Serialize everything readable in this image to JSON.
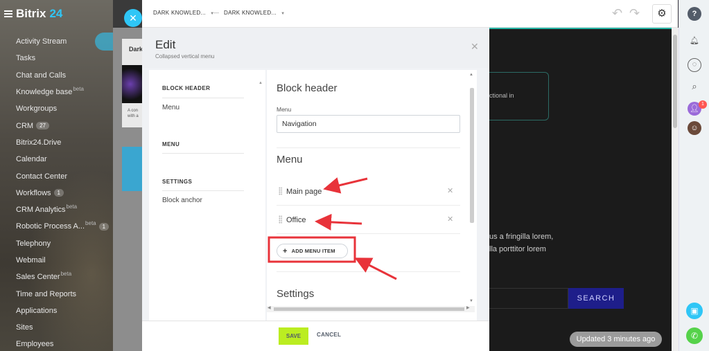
{
  "sidebar": {
    "brand_name": "Bitrix",
    "brand_number": "24",
    "items": [
      {
        "label": "Activity Stream"
      },
      {
        "label": "Tasks"
      },
      {
        "label": "Chat and Calls"
      },
      {
        "label": "Knowledge base",
        "sup": "beta"
      },
      {
        "label": "Workgroups"
      },
      {
        "label": "CRM",
        "count": "27"
      },
      {
        "label": "Bitrix24.Drive"
      },
      {
        "label": "Calendar"
      },
      {
        "label": "Contact Center"
      },
      {
        "label": "Workflows",
        "count": "1"
      },
      {
        "label": "CRM Analytics",
        "sup": "beta"
      },
      {
        "label": "Robotic Process A...",
        "sup": "beta",
        "count": "1"
      },
      {
        "label": "Telephony"
      },
      {
        "label": "Webmail"
      },
      {
        "label": "Sales Center",
        "sup": "beta"
      },
      {
        "label": "Time and Reports"
      },
      {
        "label": "Applications"
      },
      {
        "label": "Sites"
      },
      {
        "label": "Employees"
      }
    ]
  },
  "background_card": {
    "title_fragment": "Dark",
    "text_fragment_1": "A con",
    "text_fragment_2": "with a"
  },
  "toolbar": {
    "crumb_1": "DARK KNOWLED...",
    "crumb_2": "DARK KNOWLED...",
    "separator": "—"
  },
  "modal": {
    "title": "Edit",
    "subtitle": "Collapsed vertical menu",
    "left_nav": {
      "block_header_heading": "BLOCK HEADER",
      "block_header_item": "Menu",
      "menu_heading": "MENU",
      "settings_heading": "SETTINGS",
      "settings_item": "Block anchor"
    },
    "block_header_title": "Block header",
    "menu_field_label": "Menu",
    "menu_field_value": "Navigation",
    "menu_section_title": "Menu",
    "menu_items": [
      {
        "label": "Main page"
      },
      {
        "label": "Office"
      }
    ],
    "add_menu_item_label": "ADD MENU ITEM",
    "settings_section_title": "Settings",
    "save_label": "SAVE",
    "cancel_label": "CANCEL"
  },
  "preview": {
    "box_text": "ctional in",
    "text_line_1": "us a fringilla lorem,",
    "text_line_2": "lla porttitor lorem",
    "search_label": "SEARCH",
    "updated_label": "Updated 3 minutes ago"
  },
  "right_rail": {
    "notification_count": "1"
  },
  "colors": {
    "accent_blue": "#2fc6f6",
    "save_green": "#bbed21",
    "annotation_red": "#e8333a",
    "search_button": "#1e1e8a"
  }
}
